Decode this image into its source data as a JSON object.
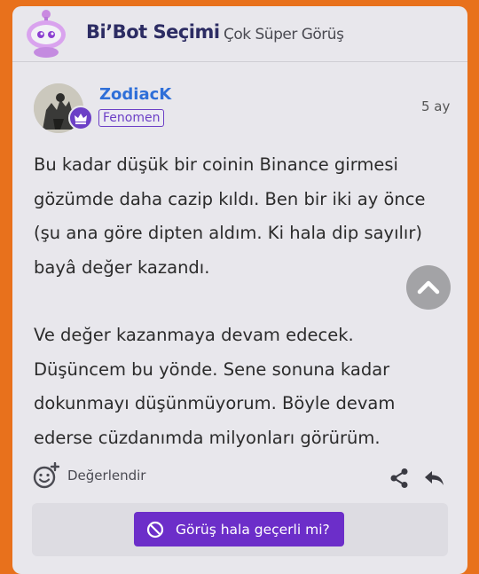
{
  "header": {
    "title": "Bi’Bot Seçimi",
    "subtitle": "Çok Süper Görüş"
  },
  "post": {
    "author": "ZodiacK",
    "role": "Fenomen",
    "time": "5 ay",
    "paragraphs": [
      "Bu kadar düşük bir coinin Binance girmesi gözümde daha cazip kıldı. Ben bir iki ay önce (şu ana göre dipten aldım. Ki hala dip sayılır) bayâ değer kazandı.",
      "Ve değer kazanmaya devam edecek. Düşüncem bu yönde. Sene sonuna kadar dokunmayı düşünmüyorum. Böyle devam ederse cüzdanımda milyonları görürüm."
    ]
  },
  "actions": {
    "rate_label": "Değerlendir",
    "opinion_button": "Görüş hala geçerli mi?"
  },
  "colors": {
    "background": "#e8711c",
    "accent_purple": "#6c2ec9",
    "username_blue": "#2f6fd8"
  },
  "icons": [
    "bot-avatar-icon",
    "crown-icon",
    "rate-smiley-icon",
    "share-icon",
    "reply-icon",
    "chevron-up-icon",
    "ban-icon"
  ]
}
